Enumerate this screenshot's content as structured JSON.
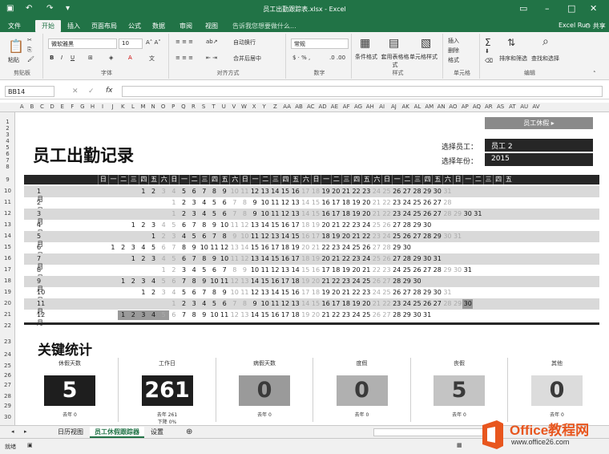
{
  "window": {
    "title": "员工出勤跟踪表.xlsx - Excel",
    "user": "Excel Run",
    "share": "共享"
  },
  "ribbon_tabs": [
    "文件",
    "开始",
    "插入",
    "页面布局",
    "公式",
    "数据",
    "审阅",
    "视图"
  ],
  "tell_me": "告诉我您想要做什么...",
  "font": {
    "name": "微软雅黑",
    "size": "10"
  },
  "number_format": "常规",
  "ribbon_groups": {
    "clipboard": "剪贴板",
    "font": "字体",
    "alignment": "对齐方式",
    "number": "数字",
    "styles": "样式",
    "cells": "单元格",
    "editing": "编辑"
  },
  "ribbon_items": {
    "paste": "粘贴",
    "wrap": "自动换行",
    "merge": "合并后居中",
    "cond": "条件格式",
    "table": "套用表格格式",
    "cellstyle": "单元格样式",
    "insert": "插入",
    "delete": "删除",
    "format": "格式",
    "sortfilter": "排序和筛选",
    "find": "查找和选择"
  },
  "formula_bar": {
    "name_box": "BB14",
    "fx": "fx",
    "value": ""
  },
  "columns": [
    "A",
    "B",
    "C",
    "D",
    "E",
    "F",
    "G",
    "H",
    "I",
    "J",
    "K",
    "L",
    "M",
    "N",
    "O",
    "P",
    "Q",
    "R",
    "S",
    "T",
    "U",
    "V",
    "W",
    "X",
    "Y",
    "Z",
    "AA",
    "AB",
    "AC",
    "AD",
    "AE",
    "AF",
    "AG",
    "AH",
    "AI",
    "AJ",
    "AK",
    "AL",
    "AM",
    "AN",
    "AO",
    "AP",
    "AQ",
    "AR",
    "AS",
    "AT",
    "AU",
    "AV"
  ],
  "rows": [
    "1",
    "2",
    "3",
    "4",
    "5",
    "6",
    "7",
    "8",
    "9",
    "10",
    "11",
    "12",
    "13",
    "14",
    "15",
    "16",
    "17",
    "18",
    "19",
    "20",
    "21",
    "22",
    "23",
    "24",
    "25",
    "26",
    "27",
    "28",
    "29",
    "30"
  ],
  "sheet": {
    "vacation_button": "员工休假 ▸",
    "title": "员工出勤记录",
    "select_employee_label": "选择员工：",
    "select_employee_value": "员工 2",
    "select_year_label": "选择年份：",
    "select_year_value": "2015",
    "weekday_header": [
      "日",
      "一",
      "二",
      "三",
      "四",
      "五",
      "六",
      "日",
      "一",
      "二",
      "三",
      "四",
      "五",
      "六",
      "日",
      "一",
      "二",
      "三",
      "四",
      "五",
      "六",
      "日",
      "一",
      "二",
      "三",
      "四",
      "五",
      "六",
      "日",
      "一",
      "二",
      "三",
      "四",
      "五",
      "六",
      "日",
      "一",
      "二",
      "三",
      "四",
      "五"
    ],
    "months": [
      {
        "name": "1月",
        "offset": 4,
        "days": 31
      },
      {
        "name": "2月",
        "offset": 7,
        "days": 28
      },
      {
        "name": "3月",
        "offset": 7,
        "days": 31
      },
      {
        "name": "4月",
        "offset": 3,
        "days": 30
      },
      {
        "name": "5月",
        "offset": 5,
        "days": 31
      },
      {
        "name": "6月",
        "offset": 1,
        "days": 30
      },
      {
        "name": "7月",
        "offset": 3,
        "days": 31
      },
      {
        "name": "8月",
        "offset": 6,
        "days": 31
      },
      {
        "name": "9月",
        "offset": 2,
        "days": 30
      },
      {
        "name": "10月",
        "offset": 4,
        "days": 31
      },
      {
        "name": "11月",
        "offset": 7,
        "days": 30
      },
      {
        "name": "12月",
        "offset": 2,
        "days": 31
      }
    ],
    "section_title": "关键统计",
    "stats": [
      {
        "label": "休假天数",
        "value": "5",
        "sub": "去年 0",
        "color": "#1e1e1e",
        "text": "#ffffff"
      },
      {
        "label": "工作日",
        "value": "261",
        "sub": "去年 261",
        "color": "#1e1e1e",
        "text": "#ffffff"
      },
      {
        "label": "病假天数",
        "value": "0",
        "sub": "去年 0",
        "color": "#9a9a9a",
        "text": "#3a3a3a"
      },
      {
        "label": "度假",
        "value": "0",
        "sub": "去年 0",
        "color": "#b0b0b0",
        "text": "#3a3a3a"
      },
      {
        "label": "丧假",
        "value": "5",
        "sub": "去年 0",
        "color": "#c4c4c4",
        "text": "#3a3a3a"
      },
      {
        "label": "其他",
        "value": "0",
        "sub": "去年 0",
        "color": "#dcdcdc",
        "text": "#3a3a3a"
      }
    ],
    "sub_note": "下降 0%"
  },
  "sheet_tabs": [
    "日历视图",
    "员工休假跟踪器",
    "设置"
  ],
  "status": "就绪",
  "logo": {
    "text": "Office教程网",
    "url": "www.office26.com"
  }
}
